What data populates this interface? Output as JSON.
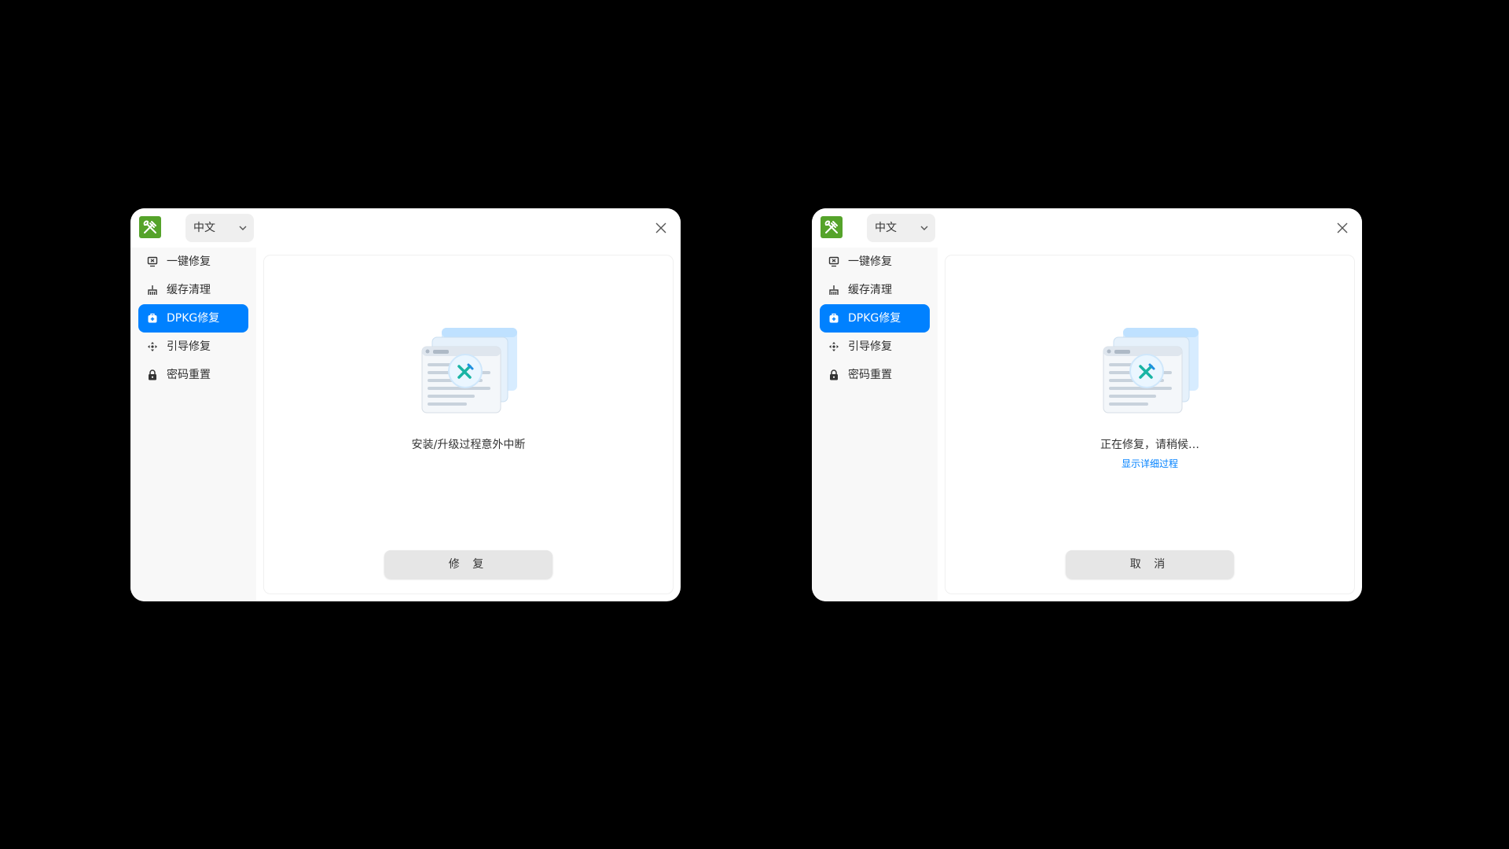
{
  "app": {
    "language": "中文",
    "nav": [
      "一键修复",
      "缓存清理",
      "DPKG修复",
      "引导修复",
      "密码重置"
    ],
    "active_index": 2
  },
  "left": {
    "status": "安装/升级过程意外中断",
    "button": "修 复"
  },
  "right": {
    "status": "正在修复，请稍候…",
    "link": "显示详细过程",
    "button": "取 消"
  },
  "colors": {
    "accent": "#0081ff",
    "app_icon": "#55a32a",
    "background": "#000000"
  }
}
